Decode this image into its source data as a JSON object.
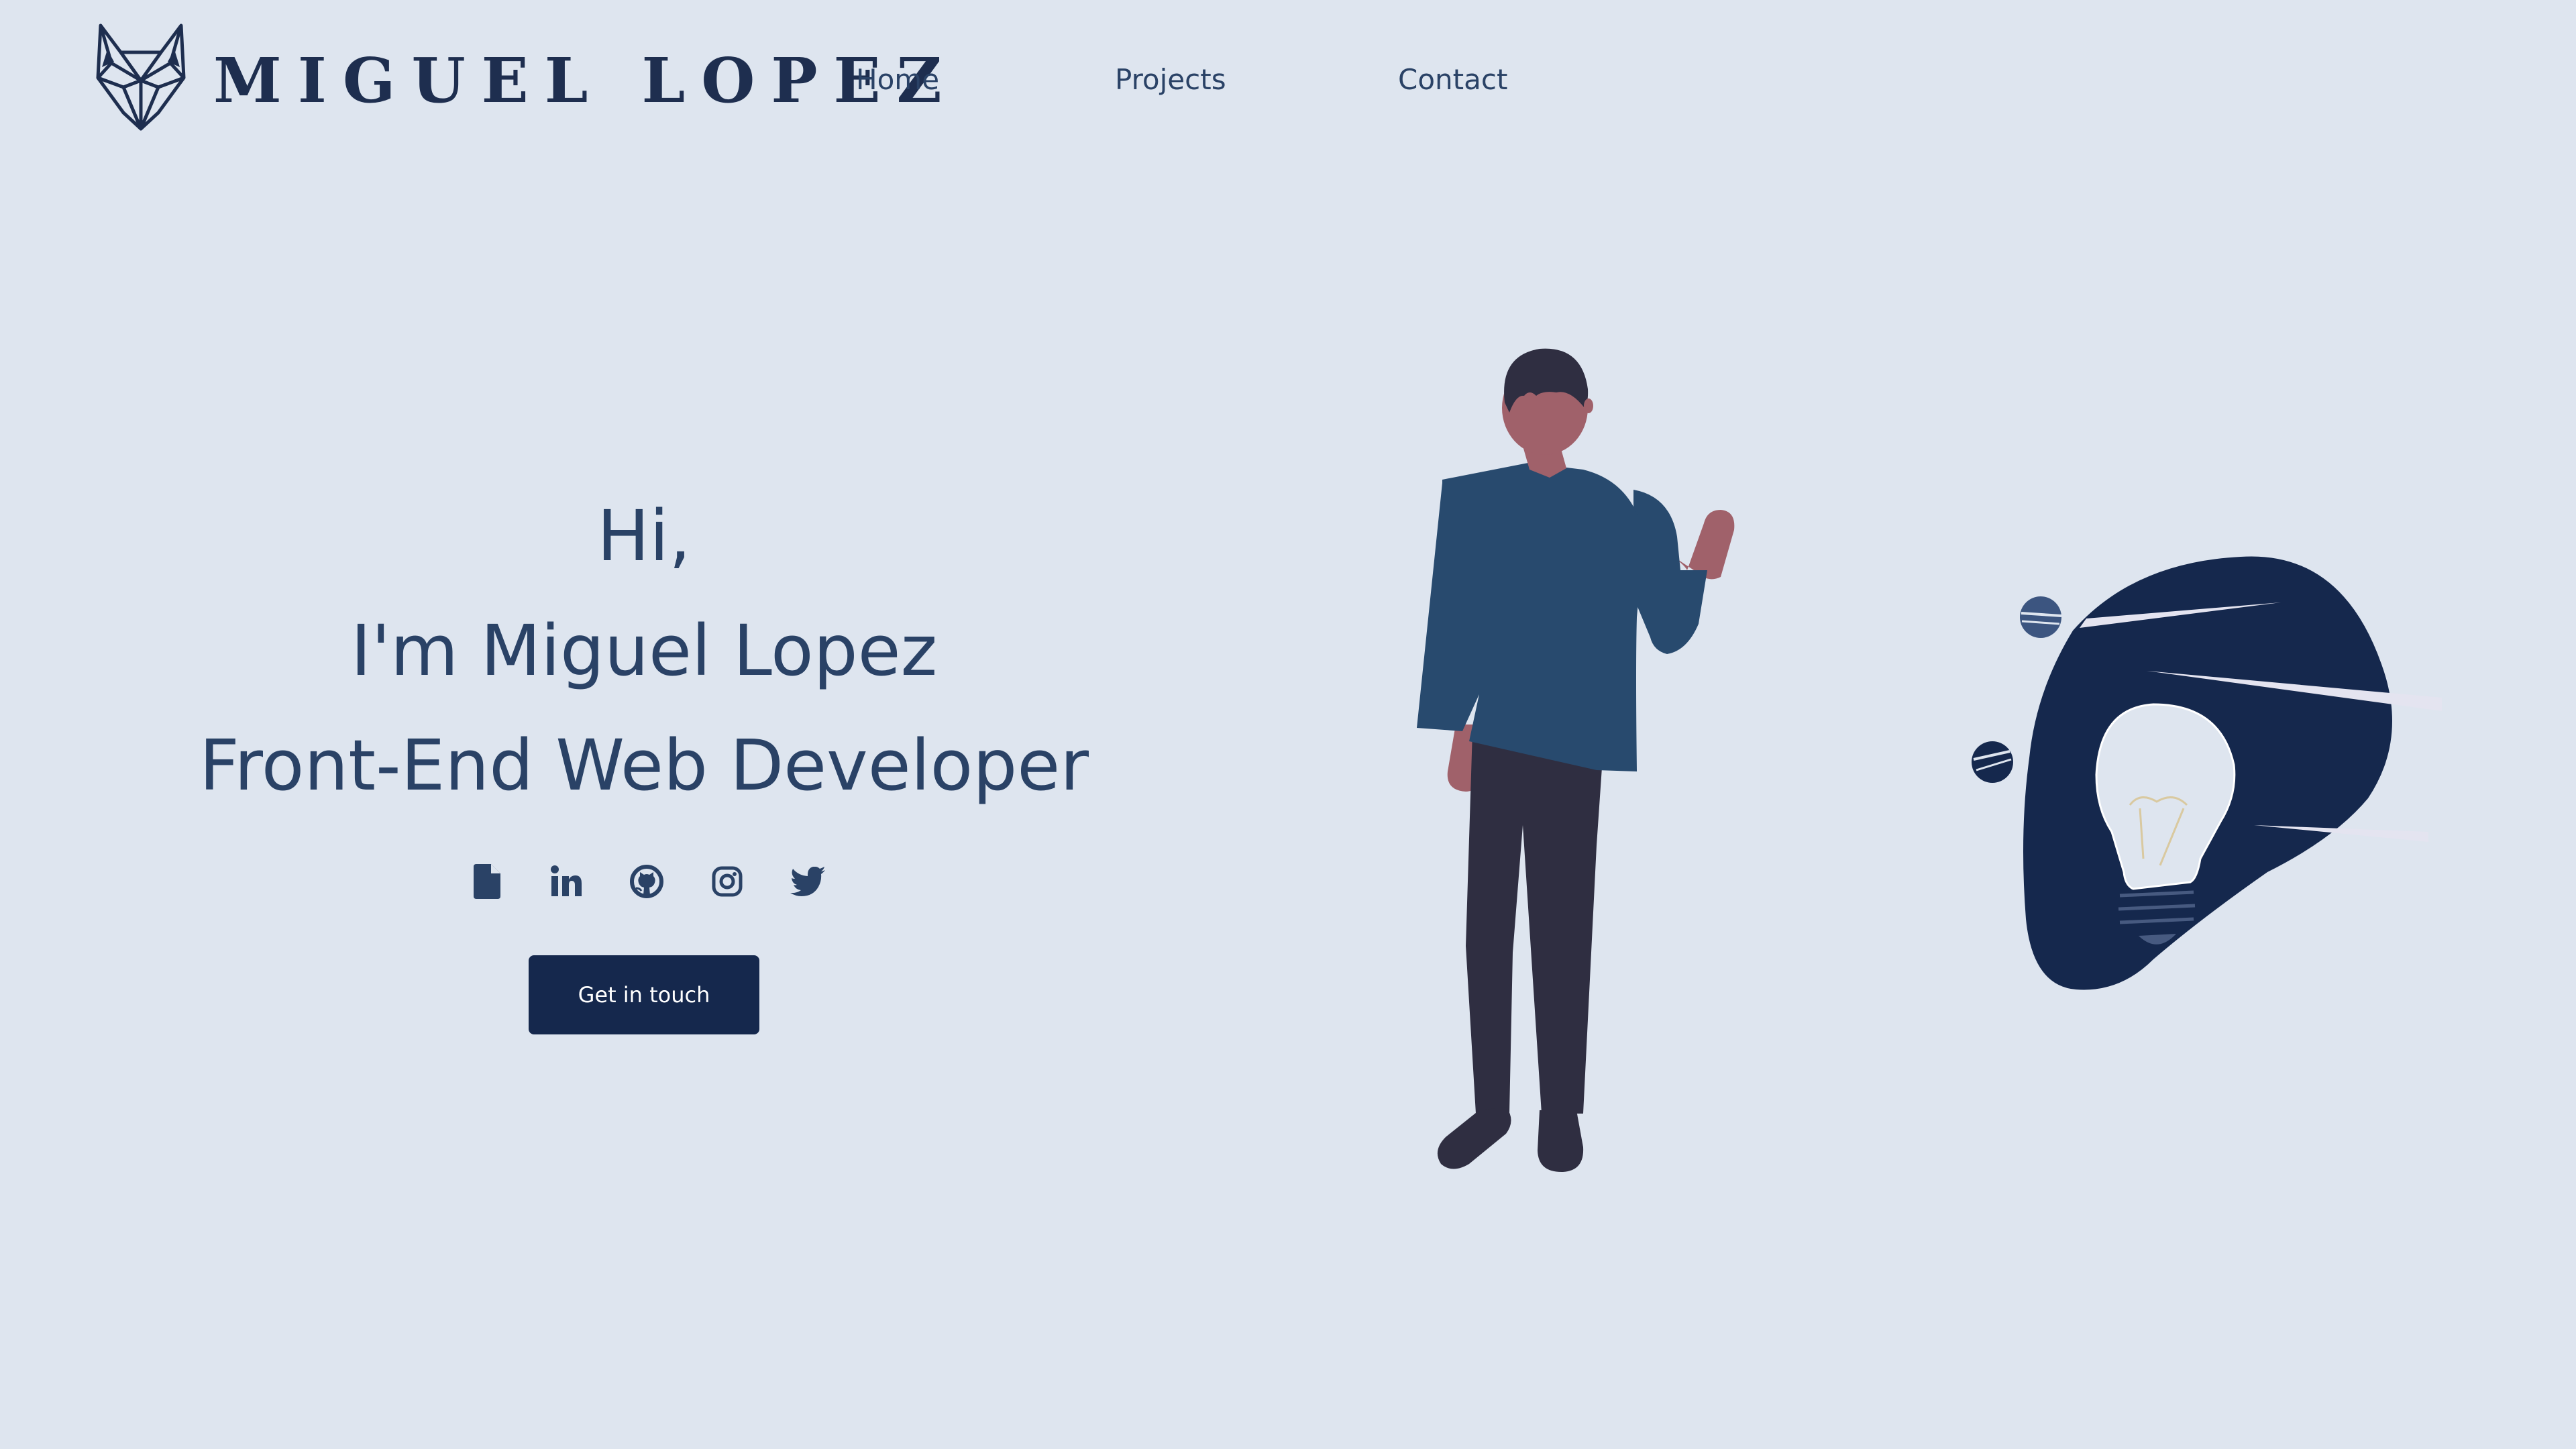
{
  "header": {
    "logo_text": "MIGUEL LOPEZ",
    "nav": {
      "home": "Home",
      "projects": "Projects",
      "contact": "Contact"
    }
  },
  "hero": {
    "line1": "Hi,",
    "line2": "I'm Miguel Lopez",
    "line3": "Front-End Web Developer",
    "cta_label": "Get in touch",
    "socials": [
      "resume-icon",
      "linkedin-icon",
      "github-icon",
      "instagram-icon",
      "twitter-icon"
    ]
  },
  "colors": {
    "background": "#dee5ef",
    "text": "#2a4266",
    "navy": "#15284d",
    "shirt": "#284a6e",
    "pants": "#2f2e41",
    "skin": "#a0616a"
  }
}
